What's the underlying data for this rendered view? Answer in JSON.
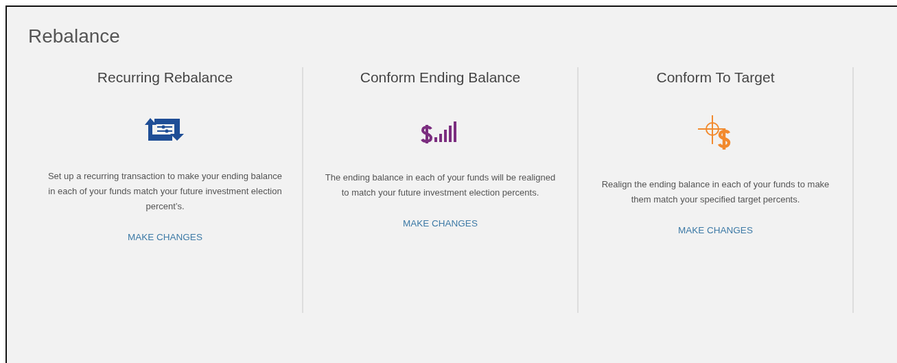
{
  "page": {
    "title": "Rebalance"
  },
  "options": [
    {
      "title": "Recurring Rebalance",
      "kind": "recurring",
      "description": "Set up a recurring transaction to make your ending balance in each of your funds match your future investment election percent’s.",
      "link": "MAKE CHANGES"
    },
    {
      "title": "Conform Ending Balance",
      "kind": "ending",
      "description": "The ending balance in each of your funds will be realigned to match your future investment election percents.",
      "link": "MAKE CHANGES"
    },
    {
      "title": "Conform To Target",
      "kind": "target",
      "description": "Realign the ending balance in each of your funds to make them match your specified target percents.",
      "link": "MAKE CHANGES"
    }
  ]
}
